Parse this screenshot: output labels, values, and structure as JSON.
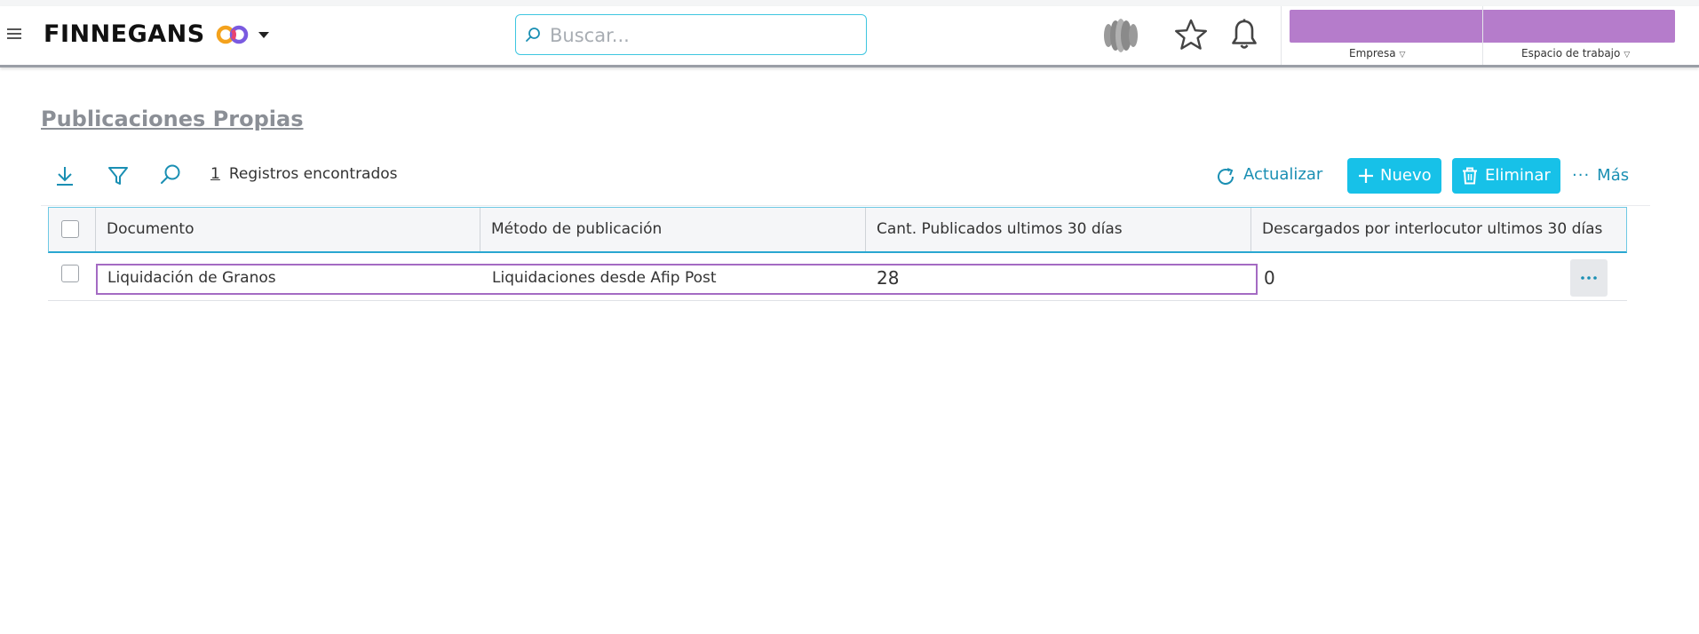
{
  "brand": {
    "name": "FINNEGANS"
  },
  "search": {
    "placeholder": "Buscar..."
  },
  "header": {
    "empresa_label": "Empresa",
    "espacio_label": "Espacio de trabajo"
  },
  "page": {
    "title": "Publicaciones Propias"
  },
  "toolbar": {
    "records_count": "1",
    "records_label": "Registros encontrados",
    "refresh_label": "Actualizar",
    "new_label": "Nuevo",
    "delete_label": "Eliminar",
    "more_label": "Más"
  },
  "table": {
    "columns": [
      "Documento",
      "Método de publicación",
      "Cant. Publicados ultimos 30 días",
      "Descargados por interlocutor ultimos 30 días"
    ],
    "rows": [
      {
        "documento": "Liquidación de Granos",
        "metodo": "Liquidaciones desde Afip Post",
        "publicados": "28",
        "descargados": "0"
      }
    ]
  },
  "colors": {
    "accent": "#17c1e8",
    "link": "#1a8fb3",
    "purple": "#b57ccb",
    "selection_border": "#a46bc3"
  }
}
